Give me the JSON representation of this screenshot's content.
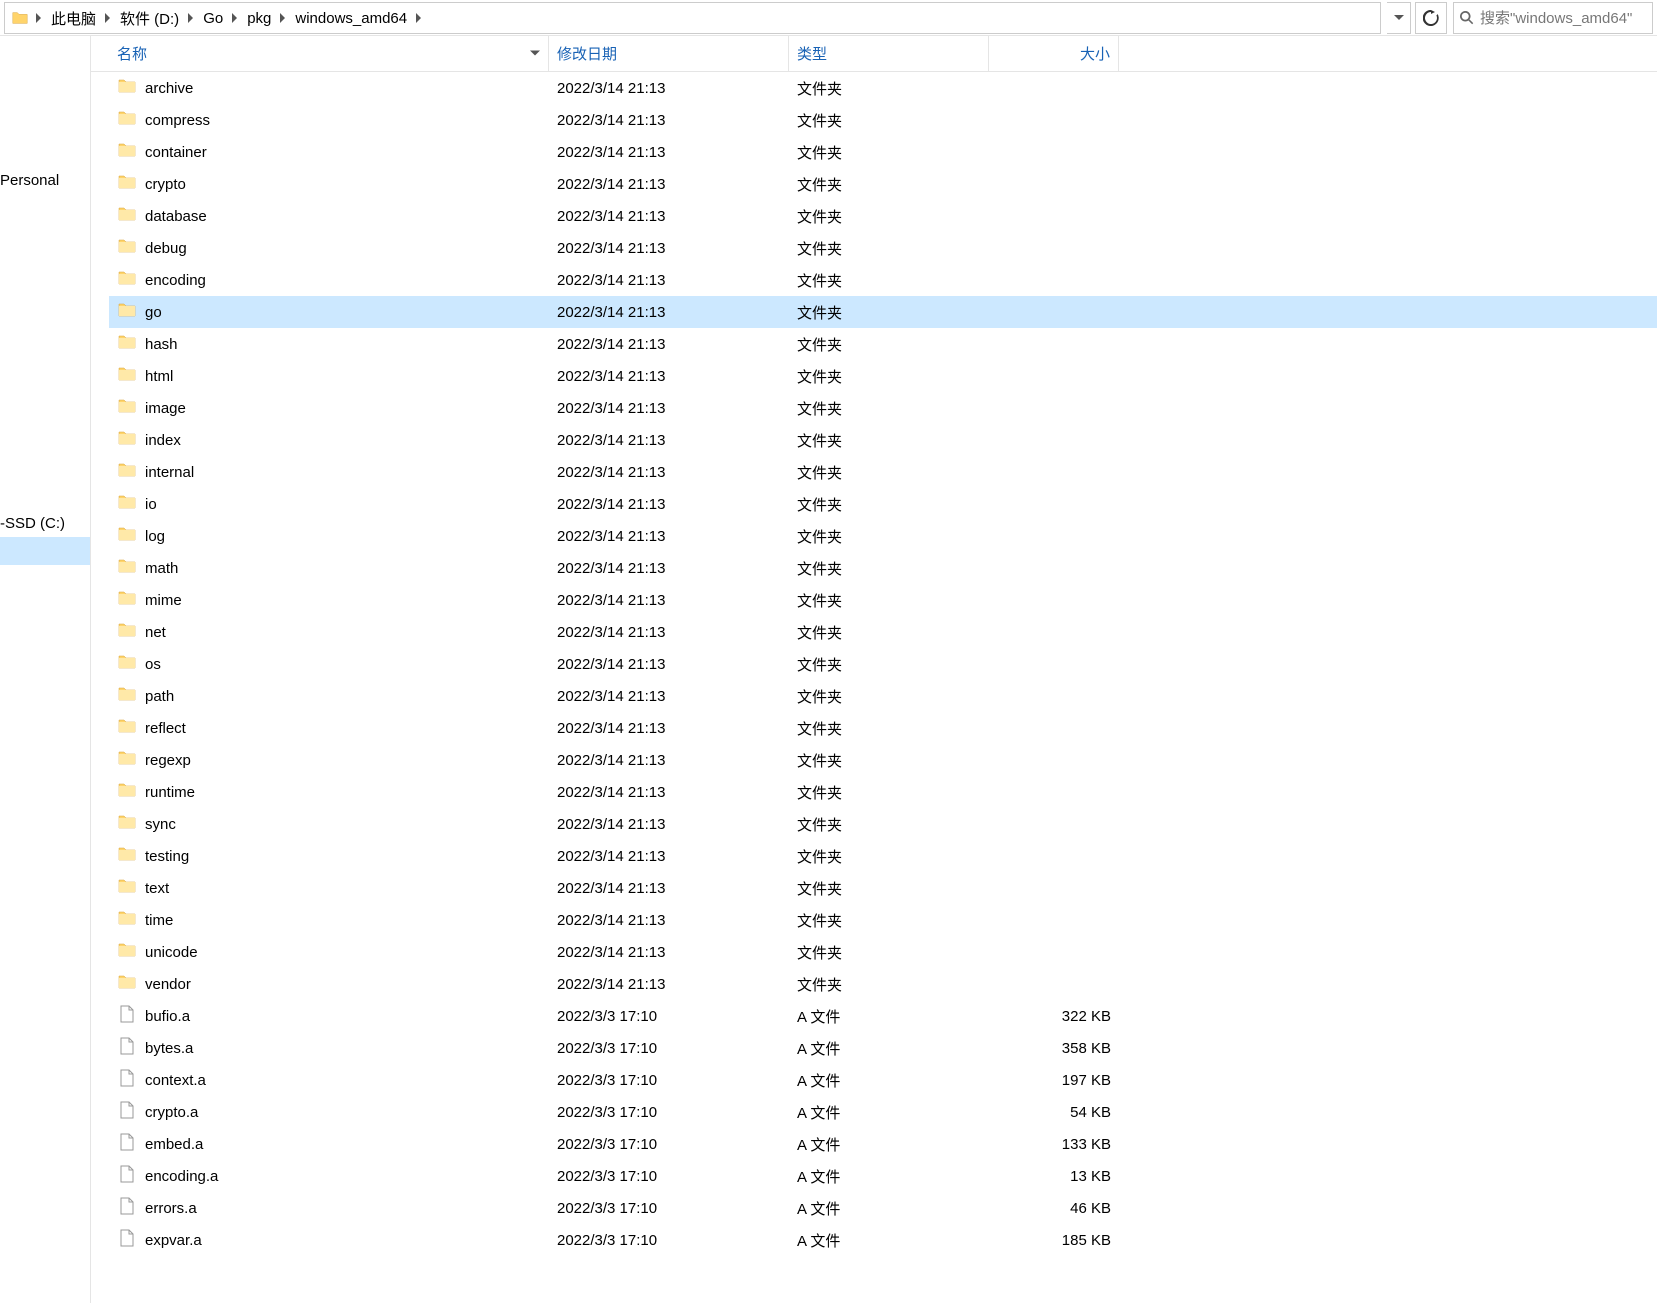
{
  "breadcrumbs": [
    "此电脑",
    "软件 (D:)",
    "Go",
    "pkg",
    "windows_amd64"
  ],
  "search_placeholder": "搜索\"windows_amd64\"",
  "nav": {
    "items": [
      {
        "label": "Personal",
        "selected": false
      },
      {
        "label": "-SSD (C:)",
        "selected": false
      },
      {
        "label": "",
        "selected": true
      }
    ]
  },
  "columns": {
    "name": "名称",
    "date": "修改日期",
    "type": "类型",
    "size": "大小"
  },
  "items": [
    {
      "name": "archive",
      "date": "2022/3/14 21:13",
      "type": "文件夹",
      "size": "",
      "kind": "folder",
      "highlight": false
    },
    {
      "name": "compress",
      "date": "2022/3/14 21:13",
      "type": "文件夹",
      "size": "",
      "kind": "folder",
      "highlight": false
    },
    {
      "name": "container",
      "date": "2022/3/14 21:13",
      "type": "文件夹",
      "size": "",
      "kind": "folder",
      "highlight": false
    },
    {
      "name": "crypto",
      "date": "2022/3/14 21:13",
      "type": "文件夹",
      "size": "",
      "kind": "folder",
      "highlight": false
    },
    {
      "name": "database",
      "date": "2022/3/14 21:13",
      "type": "文件夹",
      "size": "",
      "kind": "folder",
      "highlight": false
    },
    {
      "name": "debug",
      "date": "2022/3/14 21:13",
      "type": "文件夹",
      "size": "",
      "kind": "folder",
      "highlight": false
    },
    {
      "name": "encoding",
      "date": "2022/3/14 21:13",
      "type": "文件夹",
      "size": "",
      "kind": "folder",
      "highlight": false
    },
    {
      "name": "go",
      "date": "2022/3/14 21:13",
      "type": "文件夹",
      "size": "",
      "kind": "folder",
      "highlight": true
    },
    {
      "name": "hash",
      "date": "2022/3/14 21:13",
      "type": "文件夹",
      "size": "",
      "kind": "folder",
      "highlight": false
    },
    {
      "name": "html",
      "date": "2022/3/14 21:13",
      "type": "文件夹",
      "size": "",
      "kind": "folder",
      "highlight": false
    },
    {
      "name": "image",
      "date": "2022/3/14 21:13",
      "type": "文件夹",
      "size": "",
      "kind": "folder",
      "highlight": false
    },
    {
      "name": "index",
      "date": "2022/3/14 21:13",
      "type": "文件夹",
      "size": "",
      "kind": "folder",
      "highlight": false
    },
    {
      "name": "internal",
      "date": "2022/3/14 21:13",
      "type": "文件夹",
      "size": "",
      "kind": "folder",
      "highlight": false
    },
    {
      "name": "io",
      "date": "2022/3/14 21:13",
      "type": "文件夹",
      "size": "",
      "kind": "folder",
      "highlight": false
    },
    {
      "name": "log",
      "date": "2022/3/14 21:13",
      "type": "文件夹",
      "size": "",
      "kind": "folder",
      "highlight": false
    },
    {
      "name": "math",
      "date": "2022/3/14 21:13",
      "type": "文件夹",
      "size": "",
      "kind": "folder",
      "highlight": false
    },
    {
      "name": "mime",
      "date": "2022/3/14 21:13",
      "type": "文件夹",
      "size": "",
      "kind": "folder",
      "highlight": false
    },
    {
      "name": "net",
      "date": "2022/3/14 21:13",
      "type": "文件夹",
      "size": "",
      "kind": "folder",
      "highlight": false
    },
    {
      "name": "os",
      "date": "2022/3/14 21:13",
      "type": "文件夹",
      "size": "",
      "kind": "folder",
      "highlight": false
    },
    {
      "name": "path",
      "date": "2022/3/14 21:13",
      "type": "文件夹",
      "size": "",
      "kind": "folder",
      "highlight": false
    },
    {
      "name": "reflect",
      "date": "2022/3/14 21:13",
      "type": "文件夹",
      "size": "",
      "kind": "folder",
      "highlight": false
    },
    {
      "name": "regexp",
      "date": "2022/3/14 21:13",
      "type": "文件夹",
      "size": "",
      "kind": "folder",
      "highlight": false
    },
    {
      "name": "runtime",
      "date": "2022/3/14 21:13",
      "type": "文件夹",
      "size": "",
      "kind": "folder",
      "highlight": false
    },
    {
      "name": "sync",
      "date": "2022/3/14 21:13",
      "type": "文件夹",
      "size": "",
      "kind": "folder",
      "highlight": false
    },
    {
      "name": "testing",
      "date": "2022/3/14 21:13",
      "type": "文件夹",
      "size": "",
      "kind": "folder",
      "highlight": false
    },
    {
      "name": "text",
      "date": "2022/3/14 21:13",
      "type": "文件夹",
      "size": "",
      "kind": "folder",
      "highlight": false
    },
    {
      "name": "time",
      "date": "2022/3/14 21:13",
      "type": "文件夹",
      "size": "",
      "kind": "folder",
      "highlight": false
    },
    {
      "name": "unicode",
      "date": "2022/3/14 21:13",
      "type": "文件夹",
      "size": "",
      "kind": "folder",
      "highlight": false
    },
    {
      "name": "vendor",
      "date": "2022/3/14 21:13",
      "type": "文件夹",
      "size": "",
      "kind": "folder",
      "highlight": false
    },
    {
      "name": "bufio.a",
      "date": "2022/3/3 17:10",
      "type": "A 文件",
      "size": "322 KB",
      "kind": "file",
      "highlight": false
    },
    {
      "name": "bytes.a",
      "date": "2022/3/3 17:10",
      "type": "A 文件",
      "size": "358 KB",
      "kind": "file",
      "highlight": false
    },
    {
      "name": "context.a",
      "date": "2022/3/3 17:10",
      "type": "A 文件",
      "size": "197 KB",
      "kind": "file",
      "highlight": false
    },
    {
      "name": "crypto.a",
      "date": "2022/3/3 17:10",
      "type": "A 文件",
      "size": "54 KB",
      "kind": "file",
      "highlight": false
    },
    {
      "name": "embed.a",
      "date": "2022/3/3 17:10",
      "type": "A 文件",
      "size": "133 KB",
      "kind": "file",
      "highlight": false
    },
    {
      "name": "encoding.a",
      "date": "2022/3/3 17:10",
      "type": "A 文件",
      "size": "13 KB",
      "kind": "file",
      "highlight": false
    },
    {
      "name": "errors.a",
      "date": "2022/3/3 17:10",
      "type": "A 文件",
      "size": "46 KB",
      "kind": "file",
      "highlight": false
    },
    {
      "name": "expvar.a",
      "date": "2022/3/3 17:10",
      "type": "A 文件",
      "size": "185 KB",
      "kind": "file",
      "highlight": false
    }
  ]
}
